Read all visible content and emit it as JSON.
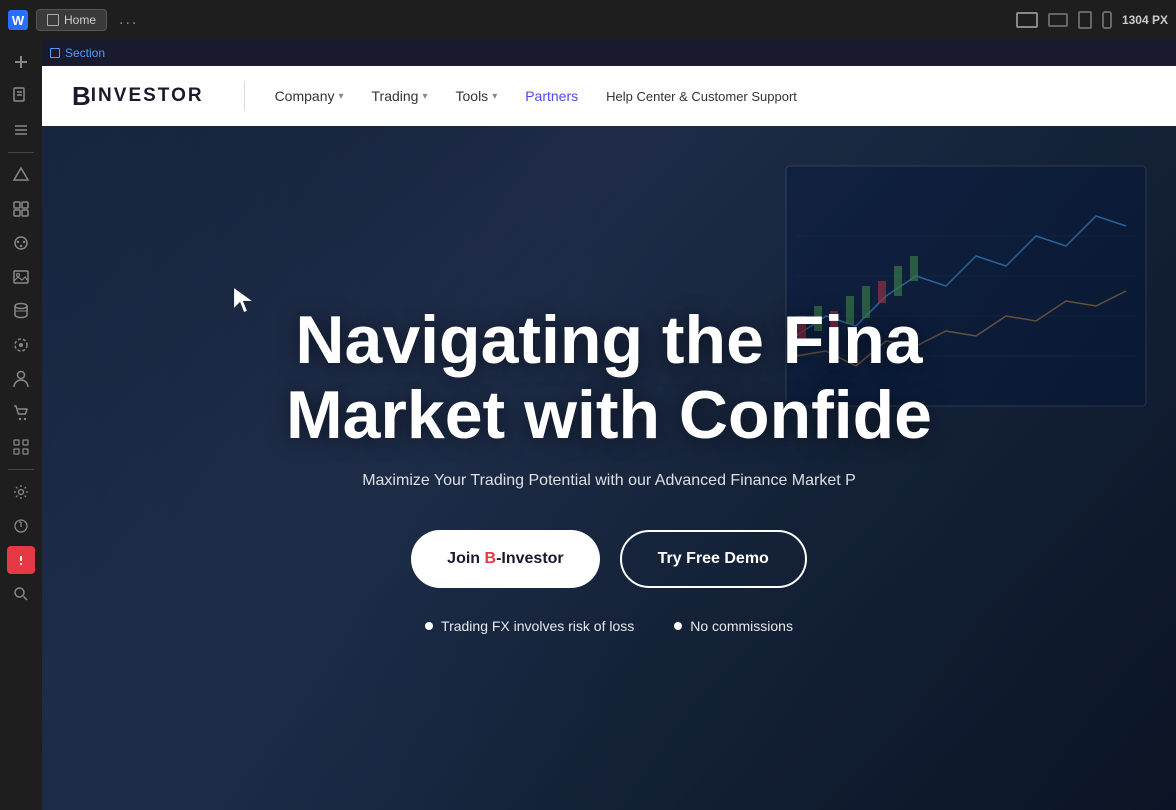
{
  "editor": {
    "top_bar": {
      "logo": "W",
      "home_tab": "Home",
      "dots": "...",
      "px_display": "1304 PX"
    },
    "viewport_icons": [
      "desktop",
      "laptop",
      "tablet",
      "mobile"
    ],
    "section_label": "Section",
    "left_sidebar": {
      "icons": [
        {
          "name": "add-icon",
          "symbol": "+"
        },
        {
          "name": "page-icon",
          "symbol": "🗋"
        },
        {
          "name": "menu-icon",
          "symbol": "≡"
        },
        {
          "name": "components-icon",
          "symbol": "⬡"
        },
        {
          "name": "widgets-icon",
          "symbol": "⊞"
        },
        {
          "name": "theme-icon",
          "symbol": "🎨"
        },
        {
          "name": "image-icon",
          "symbol": "🖼"
        },
        {
          "name": "database-icon",
          "symbol": "🗄"
        },
        {
          "name": "integrations-icon",
          "symbol": "⊕"
        },
        {
          "name": "user-icon",
          "symbol": "👤"
        },
        {
          "name": "cart-icon",
          "symbol": "🛒"
        },
        {
          "name": "apps-icon",
          "symbol": "⊞"
        },
        {
          "name": "settings-icon",
          "symbol": "⚙"
        },
        {
          "name": "help-icon",
          "symbol": "?+"
        },
        {
          "name": "search-icon",
          "symbol": "🔍"
        },
        {
          "name": "alert-icon",
          "symbol": "⚠"
        }
      ]
    }
  },
  "website": {
    "nav": {
      "logo": "BINVESTOR",
      "logo_b": "B",
      "logo_rest": "INVESTOR",
      "items": [
        {
          "label": "Company",
          "has_dropdown": true
        },
        {
          "label": "Trading",
          "has_dropdown": true
        },
        {
          "label": "Tools",
          "has_dropdown": true
        },
        {
          "label": "Partners",
          "has_dropdown": false,
          "color": "blue"
        },
        {
          "label": "Help Center & Customer Support",
          "has_dropdown": false
        }
      ]
    },
    "hero": {
      "title_line1": "Navigating the Fina",
      "title_line2": "Market with Confide",
      "subtitle": "Maximize Your Trading Potential with our Advanced Finance Market P",
      "btn_primary": "Join B-Investor",
      "btn_primary_highlight": "B",
      "btn_secondary": "Try Free Demo",
      "badge1": "Trading FX involves risk of loss",
      "badge2": "No commissions"
    }
  }
}
